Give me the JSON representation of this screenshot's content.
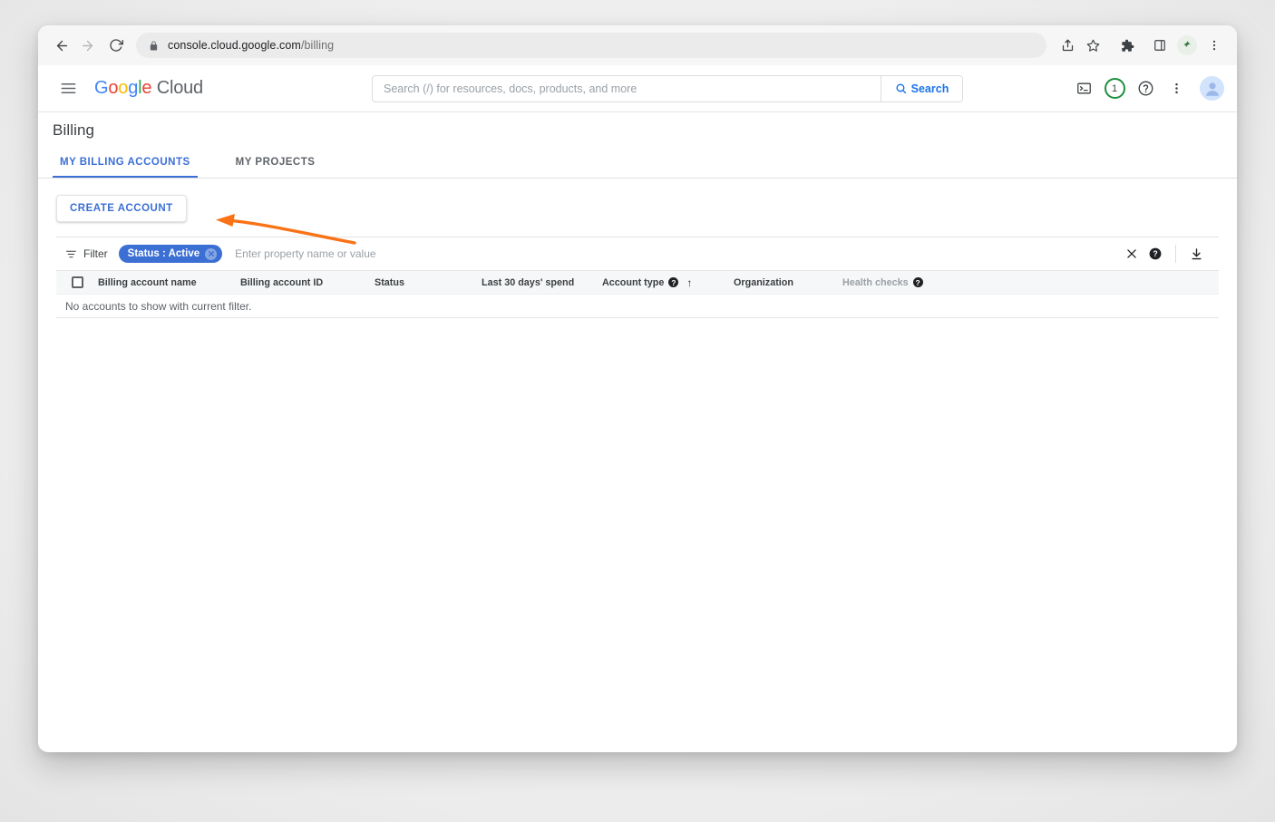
{
  "browser": {
    "url_domain": "console.cloud.google.com",
    "url_path": "/billing",
    "back_icon": "back-arrow-icon",
    "forward_icon": "forward-arrow-icon",
    "reload_icon": "reload-icon",
    "lock_icon": "lock-icon",
    "share_icon": "share-icon",
    "bookmark_icon": "star-icon",
    "extensions_icon": "puzzle-icon",
    "sidepanel_icon": "side-panel-icon",
    "profile_icon": "profile-avatar-icon",
    "menu_icon": "three-dot-menu-icon"
  },
  "header": {
    "menu_icon": "hamburger-menu-icon",
    "logo_google": "Google",
    "logo_cloud": "Cloud",
    "search": {
      "placeholder": "Search (/) for resources, docs, products, and more",
      "value": "",
      "button_label": "Search",
      "button_icon": "search-icon"
    },
    "cloud_shell_icon": "cloud-shell-icon",
    "notification_count": "1",
    "help_icon": "help-icon",
    "more_icon": "three-dot-menu-icon",
    "avatar_icon": "user-avatar-icon"
  },
  "page": {
    "title": "Billing",
    "tabs": [
      {
        "label": "MY BILLING ACCOUNTS",
        "active": true
      },
      {
        "label": "MY PROJECTS",
        "active": false
      }
    ],
    "create_account_label": "CREATE ACCOUNT",
    "annotation": {
      "type": "arrow",
      "color": "#f97316",
      "points_to": "create-account-button"
    }
  },
  "filter": {
    "icon": "filter-icon",
    "label": "Filter",
    "chip": {
      "text": "Status : Active",
      "remove_icon": "chip-remove-icon"
    },
    "input_placeholder": "Enter property name or value",
    "input_value": "",
    "clear_icon": "clear-x-icon",
    "help_icon": "help-icon",
    "download_icon": "download-icon"
  },
  "table": {
    "select_all_checkbox": "unchecked",
    "columns": [
      {
        "label": "Billing account name",
        "help": false,
        "sorted": false,
        "muted": false
      },
      {
        "label": "Billing account ID",
        "help": false,
        "sorted": false,
        "muted": false
      },
      {
        "label": "Status",
        "help": false,
        "sorted": false,
        "muted": false
      },
      {
        "label": "Last 30 days' spend",
        "help": false,
        "sorted": false,
        "muted": false
      },
      {
        "label": "Account type",
        "help": true,
        "sorted": true,
        "sort_icon": "↑",
        "muted": false
      },
      {
        "label": "Organization",
        "help": false,
        "sorted": false,
        "muted": false
      },
      {
        "label": "Health checks",
        "help": true,
        "sorted": false,
        "muted": true
      }
    ],
    "empty_message": "No accounts to show with current filter."
  },
  "colors": {
    "accent_blue": "#3b6fd4",
    "link_blue": "#1a73e8",
    "annotation_orange": "#f97316",
    "notification_green": "#1e8e3e"
  }
}
